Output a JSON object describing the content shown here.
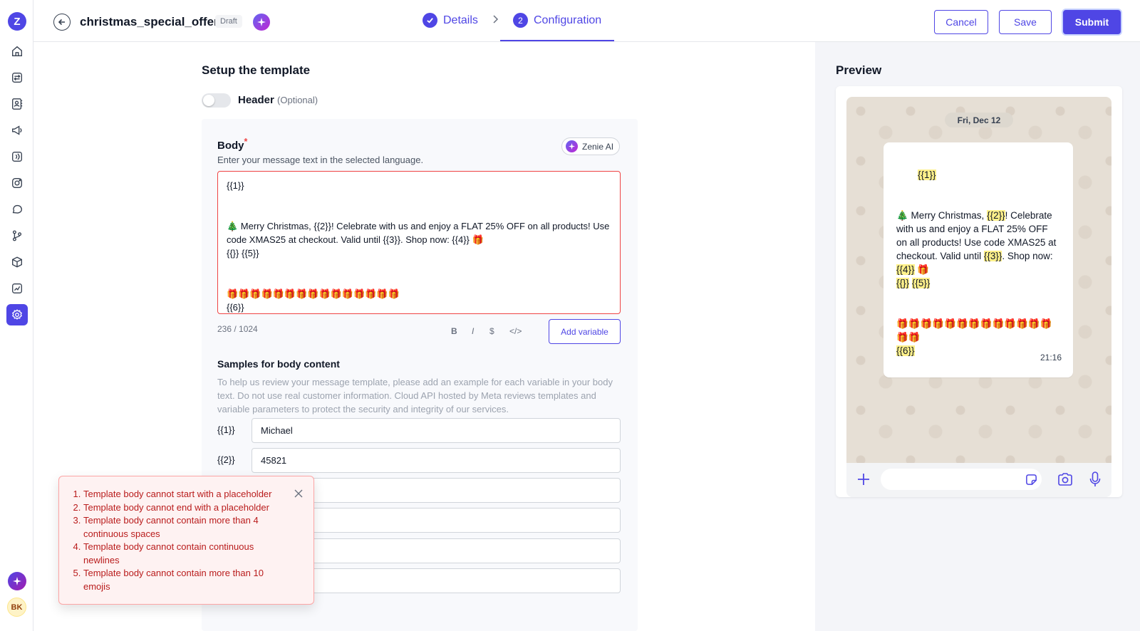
{
  "sidebar": {
    "logo": "Z",
    "icons": [
      "home-icon",
      "swap-icon",
      "contacts-icon",
      "campaign-icon",
      "broadcast-icon",
      "instagram-icon",
      "chat-icon",
      "flow-icon",
      "box-icon",
      "analytics-icon",
      "settings-icon"
    ],
    "active": "settings-icon",
    "avatar_initials": "BK"
  },
  "topbar": {
    "template_name": "christmas_special_offer",
    "status_badge": "Draft",
    "steps": [
      {
        "label": "Details",
        "state": "done"
      },
      {
        "label": "Configuration",
        "number": "2",
        "state": "active"
      }
    ],
    "cancel_label": "Cancel",
    "save_label": "Save",
    "submit_label": "Submit"
  },
  "setup": {
    "title": "Setup the template",
    "header_toggle_label": "Header",
    "header_optional": "(Optional)",
    "header_enabled": false
  },
  "body": {
    "label": "Body",
    "required_mark": "*",
    "subtitle": "Enter your message text in the selected language.",
    "zenie_label": "Zenie AI",
    "text": "{{1}}\n\n\n🎄 Merry Christmas, {{2}}! Celebrate with us and enjoy a FLAT 25% OFF on all products! Use code XMAS25 at checkout. Valid until {{3}}. Shop now: {{4}} 🎁\n{{}} {{5}}\n\n\n🎁🎁🎁🎁🎁🎁🎁🎁🎁🎁🎁🎁🎁🎁🎁\n{{6}}",
    "char_count": "236 / 1024",
    "format_buttons": [
      "B",
      "I",
      "$",
      "</>"
    ],
    "add_variable_label": "Add variable"
  },
  "samples": {
    "title": "Samples for body content",
    "description": "To help us review your message template, please add an example for each variable in your body text. Do not use real customer information. Cloud API hosted by Meta reviews templates and variable parameters to protect the security and integrity of our services.",
    "variables": [
      {
        "label": "{{1}}",
        "value": "Michael"
      },
      {
        "label": "{{2}}",
        "value": "45821"
      },
      {
        "label": "",
        "value": ""
      },
      {
        "label": "",
        "value": ""
      },
      {
        "label": "",
        "value": ""
      },
      {
        "label": "",
        "value": ""
      }
    ]
  },
  "errors": {
    "items": [
      "Template body cannot start with a placeholder",
      "Template body cannot end with a placeholder",
      "Template body cannot contain more than 4 continuous spaces",
      "Template body cannot contain continuous newlines",
      "Template body cannot contain more than 10 emojis"
    ]
  },
  "preview": {
    "title": "Preview",
    "date": "Fri, Dec 12",
    "time": "21:16",
    "message_parts": [
      {
        "t": "{{1}}",
        "hl": true
      },
      {
        "t": "\n\n\n🎄 Merry Christmas, ",
        "hl": false
      },
      {
        "t": "{{2}}",
        "hl": true
      },
      {
        "t": "! Celebrate with us and enjoy a FLAT 25% OFF on all products! Use code XMAS25 at checkout. Valid until ",
        "hl": false
      },
      {
        "t": "{{3}}",
        "hl": true
      },
      {
        "t": ". Shop now: ",
        "hl": false
      },
      {
        "t": "{{4}}",
        "hl": true
      },
      {
        "t": " 🎁\n",
        "hl": false
      },
      {
        "t": "{{}}",
        "hl": true
      },
      {
        "t": " ",
        "hl": false
      },
      {
        "t": "{{5}}",
        "hl": true
      },
      {
        "t": "\n\n\n🎁🎁🎁🎁🎁🎁🎁🎁🎁🎁🎁🎁🎁🎁🎁\n",
        "hl": false
      },
      {
        "t": "{{6}}",
        "hl": true
      }
    ]
  },
  "colors": {
    "accent": "#4f46e5",
    "error": "#ef4444",
    "highlight": "#fef08a"
  }
}
